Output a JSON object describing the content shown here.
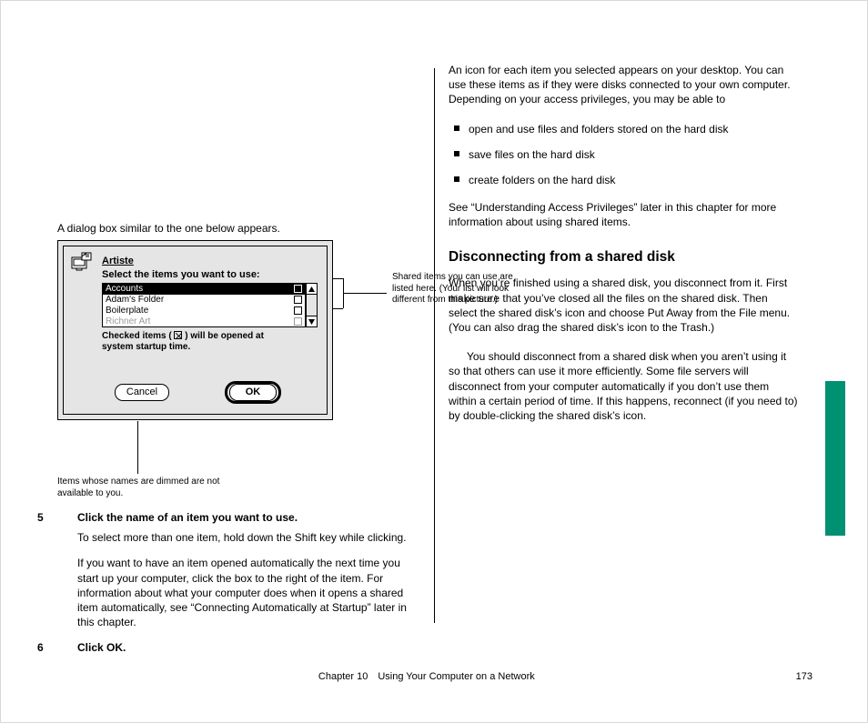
{
  "left": {
    "p1": "A dialog box similar to the one below appears.",
    "hint_text_a": "Checked items ( ",
    "hint_text_b": " ) will be opened at system startup time.",
    "dialog": {
      "server_name": "Artiste",
      "instruction": "Select the items you want to use:",
      "items": [
        {
          "label": "Accounts",
          "selected": true,
          "dimmed": false
        },
        {
          "label": "Adam's Folder",
          "selected": false,
          "dimmed": false
        },
        {
          "label": "Boilerplate",
          "selected": false,
          "dimmed": false
        },
        {
          "label": "Richner Art",
          "selected": false,
          "dimmed": true
        }
      ],
      "cancel": "Cancel",
      "ok": "OK"
    },
    "callout_items": "Shared items you can use are listed here. (Your list will look different from this picture.)",
    "callout_dimmed": "Items whose names are dimmed are not available to you.",
    "step5": "Click the name of an item you want to use.",
    "step5_body": "To select more than one item, hold down the Shift key while clicking.",
    "step5_body2a": "If you want to have an item opened automatically the next time you start up your computer, click the box to the right of the item. For information about what your computer does when it opens a shared item automatically, see “Connecting Automatically at Startup” later in this chapter.",
    "step6": "Click OK."
  },
  "right": {
    "p1": "An icon for each item you selected appears on your desktop. You can use these items as if they were disks connected to your own computer. Depending on your access privileges, you may be able to",
    "bullets": [
      "open and use files and folders stored on the hard disk",
      "save files on the hard disk",
      "create folders on the hard disk"
    ],
    "p2": "See “Understanding Access Privileges” later in this chapter for more information about using shared items.",
    "h2": "Disconnecting from a shared disk",
    "p3_a": "When you’re finished using a shared disk, you disconnect from it. First make sure that you’ve closed all the files on the shared disk. Then select the shared disk’s icon and choose Put Away from the File menu. (You can also drag the shared disk’s icon to the Trash.)",
    "p4": "You should disconnect from a shared disk when you aren’t using it so that others can use it more efficiently. Some file servers will disconnect from your computer automatically if you don’t use them within a certain period of time. If this happens, reconnect (if you need to) by double-clicking the shared disk’s icon."
  },
  "footer": {
    "left": "",
    "center": "Chapter 10 Using Your Computer on a Network",
    "right": "173"
  }
}
